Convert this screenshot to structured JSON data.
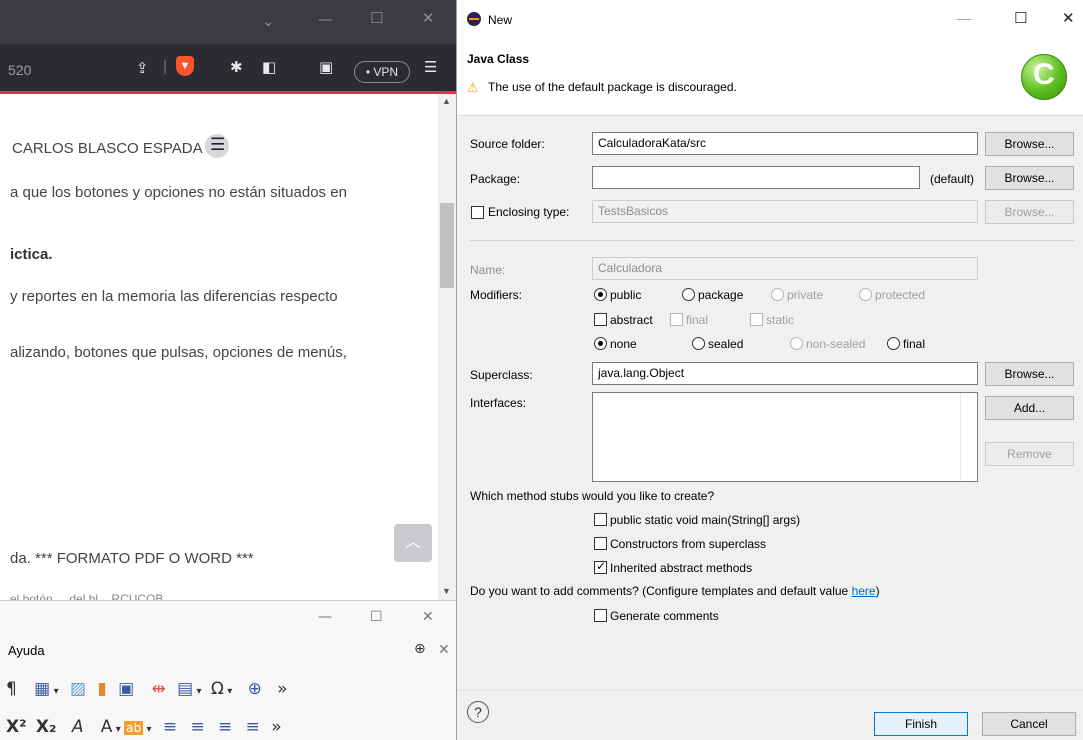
{
  "browser": {
    "url_fragment": "520",
    "vpn_label": "• VPN",
    "author": "CARLOS BLASCO ESPADA",
    "lines": [
      "a que los botones y opciones no están situados en",
      "ictica.",
      "y reportes en la memoria las diferencias respecto",
      "alizando, botones que pulsas, opciones de menús,",
      "da. *** FORMATO PDF O WORD ***",
      "el botón ... del bl... RCUCOB ... ... ..."
    ],
    "icons": [
      "share-icon",
      "brave-shield-icon",
      "extensions-icon",
      "sidebar-icon",
      "wallet-icon",
      "menu-icon"
    ]
  },
  "writer": {
    "menu_label": "Ayuda",
    "toolbar_row1": [
      "¶",
      "▦",
      "▾",
      "▨",
      "▮",
      "▣",
      "⇹",
      "▤",
      "▾",
      "Ω",
      "▾",
      "⊕",
      "»"
    ],
    "toolbar_row2": [
      "X²",
      "X₂",
      "A",
      "A",
      "▾",
      "ab",
      "▾",
      "≡",
      "≡",
      "≡",
      "≡",
      "»"
    ]
  },
  "dialog": {
    "window_title": "New",
    "header_title": "Java Class",
    "warning": "The use of the default package is discouraged.",
    "source_folder": {
      "label": "Source folder:",
      "value": "CalculadoraKata/src",
      "button": "Browse..."
    },
    "package": {
      "label": "Package:",
      "value": "",
      "default_label": "(default)",
      "button": "Browse..."
    },
    "enclosing": {
      "label": "Enclosing type:",
      "value": "TestsBasicos",
      "button": "Browse..."
    },
    "name": {
      "label": "Name:",
      "value": "Calculadora"
    },
    "modifiers": {
      "label": "Modifiers:",
      "access": [
        "public",
        "package",
        "private",
        "protected"
      ],
      "flags": [
        "abstract",
        "final",
        "static"
      ],
      "sealed": [
        "none",
        "sealed",
        "non-sealed",
        "final"
      ]
    },
    "superclass": {
      "label": "Superclass:",
      "value": "java.lang.Object",
      "button": "Browse..."
    },
    "interfaces": {
      "label": "Interfaces:",
      "add": "Add...",
      "remove": "Remove"
    },
    "stubs_question": "Which method stubs would you like to create?",
    "stubs": [
      "public static void main(String[] args)",
      "Constructors from superclass",
      "Inherited abstract methods"
    ],
    "comments_question": "Do you want to add comments? (Configure templates and default value ",
    "comments_link": "here",
    "comments_close": ")",
    "generate_comments": "Generate comments",
    "finish": "Finish",
    "cancel": "Cancel"
  }
}
